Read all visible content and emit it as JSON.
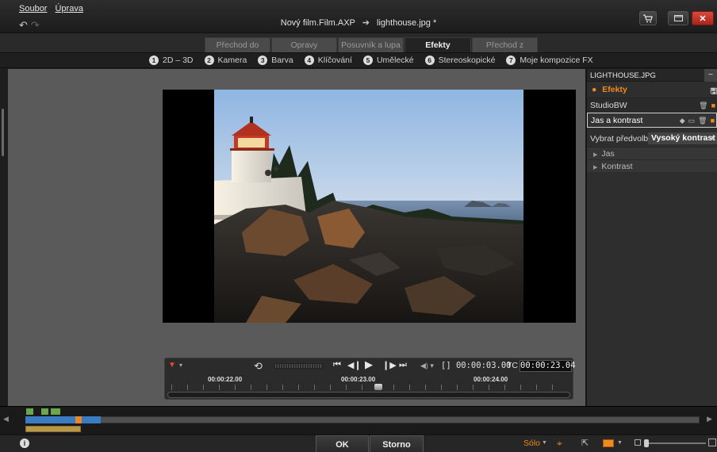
{
  "menu": {
    "file": "Soubor",
    "edit": "Úprava"
  },
  "window": {
    "project": "Nový film.Film.AXP",
    "arrow": "➔",
    "file": "lighthouse.jpg",
    "modified": "*"
  },
  "tabs": [
    {
      "label": "Přechod do"
    },
    {
      "label": "Opravy"
    },
    {
      "label": "Posuvník a lupa"
    },
    {
      "label": "Efekty"
    },
    {
      "label": "Přechod z"
    }
  ],
  "active_tab": "Efekty",
  "categories": [
    {
      "num": "1",
      "label": "2D – 3D"
    },
    {
      "num": "2",
      "label": "Kamera"
    },
    {
      "num": "3",
      "label": "Barva"
    },
    {
      "num": "4",
      "label": "Klíčování"
    },
    {
      "num": "5",
      "label": "Umělecké"
    },
    {
      "num": "6",
      "label": "Stereoskopické"
    },
    {
      "num": "7",
      "label": "Moje kompozice FX"
    }
  ],
  "transport": {
    "duration": "[] 00:00:03.00",
    "tc_label": "TC",
    "timecode": "00:00:23.04",
    "ruler": [
      "00:00:22.00",
      "00:00:23.00",
      "00:00:24.00"
    ]
  },
  "panel": {
    "title": "LIGHTHOUSE.JPG",
    "section": "Efekty",
    "effects": [
      {
        "name": "StudioBW",
        "selected": false
      },
      {
        "name": "Jas a kontrast",
        "selected": true
      }
    ],
    "preset_label": "Vybrat předvolbu",
    "preset_value": "Vysoký kontrast",
    "params": [
      "Jas",
      "Kontrast"
    ]
  },
  "bottom": {
    "ok": "OK",
    "cancel": "Storno",
    "solo": "Sólo",
    "info": "i"
  },
  "colors": {
    "accent": "#f08a1c",
    "close": "#c83228",
    "clip": "#3a7cc4"
  }
}
